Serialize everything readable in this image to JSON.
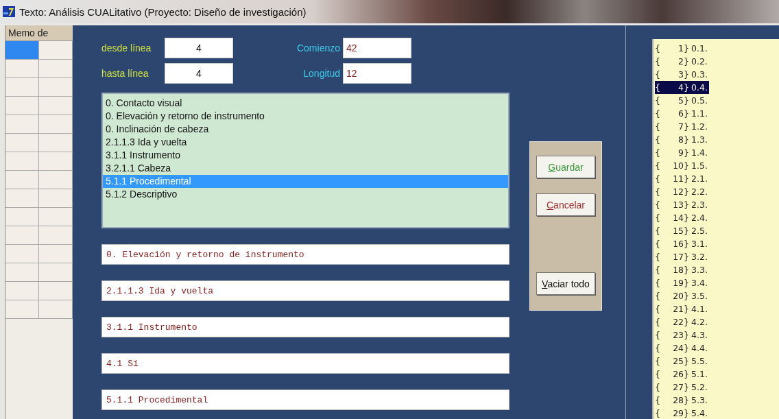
{
  "window": {
    "title": "Texto: Análisis CUALitativo (Proyecto: Diseño de investigación)"
  },
  "memo_grid": {
    "header": "Memo de",
    "rows": [
      {
        "selected": true
      },
      {
        "selected": false
      },
      {
        "selected": false
      },
      {
        "selected": false
      },
      {
        "selected": false
      },
      {
        "selected": false
      },
      {
        "selected": false
      },
      {
        "selected": false
      },
      {
        "selected": false
      },
      {
        "selected": false
      },
      {
        "selected": false
      },
      {
        "selected": false
      },
      {
        "selected": false
      },
      {
        "selected": false
      },
      {
        "selected": false
      }
    ]
  },
  "range": {
    "from_label": "desde línea",
    "from_value": "4",
    "to_label": "hasta línea",
    "to_value": "4",
    "start_label": "Comienzo",
    "start_value": "42",
    "length_label": "Longitud",
    "length_value": "12"
  },
  "codes_list": [
    {
      "text": "0. Contacto visual",
      "selected": false
    },
    {
      "text": "0. Elevación y retorno de instrumento",
      "selected": false
    },
    {
      "text": "0. Inclinación de cabeza",
      "selected": false
    },
    {
      "text": "2.1.1.3 Ida y vuelta",
      "selected": false
    },
    {
      "text": "3.1.1 Instrumento",
      "selected": false
    },
    {
      "text": "3.2.1.1 Cabeza",
      "selected": false
    },
    {
      "text": "5.1.1 Procedimental",
      "selected": true
    },
    {
      "text": "5.1.2 Descriptivo",
      "selected": false
    }
  ],
  "assigned_fields": [
    "0. Elevación y retorno de instrumento",
    "2.1.1.3 Ida y vuelta",
    "3.1.1 Instrumento",
    "4.1 Sí",
    "5.1.1 Procedimental"
  ],
  "buttons": [
    {
      "label": "Guardar",
      "kind": "save"
    },
    {
      "label": "Cancelar",
      "kind": "cancel"
    },
    {
      "label": "Vaciar todo",
      "kind": "clear"
    }
  ],
  "line_list": [
    {
      "brace": "{",
      "num": "1}",
      "code": "0.1.",
      "selected": false
    },
    {
      "brace": "{",
      "num": "2}",
      "code": "0.2.",
      "selected": false
    },
    {
      "brace": "{",
      "num": "3}",
      "code": "0.3.",
      "selected": false
    },
    {
      "brace": "{",
      "num": "4}",
      "code": "0.4.",
      "selected": true
    },
    {
      "brace": "{",
      "num": "5}",
      "code": "0.5.",
      "selected": false
    },
    {
      "brace": "{",
      "num": "6}",
      "code": "1.1.",
      "selected": false
    },
    {
      "brace": "{",
      "num": "7}",
      "code": "1.2.",
      "selected": false
    },
    {
      "brace": "{",
      "num": "8}",
      "code": "1.3.",
      "selected": false
    },
    {
      "brace": "{",
      "num": "9}",
      "code": "1.4.",
      "selected": false
    },
    {
      "brace": "{",
      "num": "10}",
      "code": "1.5.",
      "selected": false
    },
    {
      "brace": "{",
      "num": "11}",
      "code": "2.1.",
      "selected": false
    },
    {
      "brace": "{",
      "num": "12}",
      "code": "2.2.",
      "selected": false
    },
    {
      "brace": "{",
      "num": "13}",
      "code": "2.3.",
      "selected": false
    },
    {
      "brace": "{",
      "num": "14}",
      "code": "2.4.",
      "selected": false
    },
    {
      "brace": "{",
      "num": "15}",
      "code": "2.5.",
      "selected": false
    },
    {
      "brace": "{",
      "num": "16}",
      "code": "3.1.",
      "selected": false
    },
    {
      "brace": "{",
      "num": "17}",
      "code": "3.2.",
      "selected": false
    },
    {
      "brace": "{",
      "num": "18}",
      "code": "3.3.",
      "selected": false
    },
    {
      "brace": "{",
      "num": "19}",
      "code": "3.4.",
      "selected": false
    },
    {
      "brace": "{",
      "num": "20}",
      "code": "3.5.",
      "selected": false
    },
    {
      "brace": "{",
      "num": "21}",
      "code": "4.1.",
      "selected": false
    },
    {
      "brace": "{",
      "num": "22}",
      "code": "4.2.",
      "selected": false
    },
    {
      "brace": "{",
      "num": "23}",
      "code": "4.3.",
      "selected": false
    },
    {
      "brace": "{",
      "num": "24}",
      "code": "4.4.",
      "selected": false
    },
    {
      "brace": "{",
      "num": "25}",
      "code": "5.5.",
      "selected": false
    },
    {
      "brace": "{",
      "num": "26}",
      "code": "5.1.",
      "selected": false
    },
    {
      "brace": "{",
      "num": "27}",
      "code": "5.2.",
      "selected": false
    },
    {
      "brace": "{",
      "num": "28}",
      "code": "5.3.",
      "selected": false
    },
    {
      "brace": "{",
      "num": "29}",
      "code": "5.4.",
      "selected": false
    }
  ]
}
